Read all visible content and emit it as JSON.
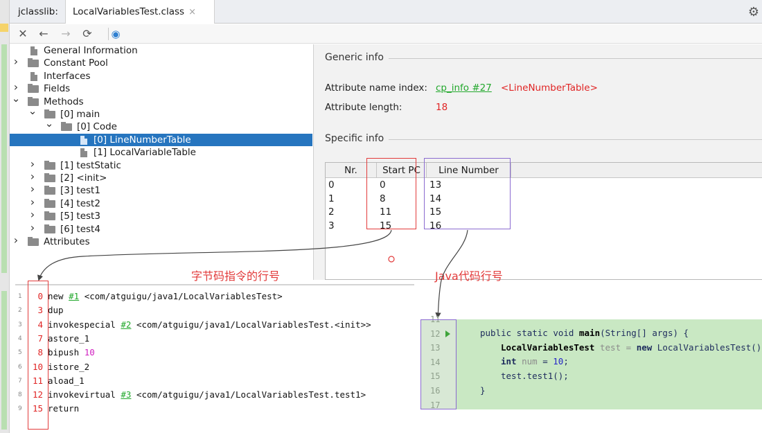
{
  "tabs": [
    {
      "label": "jclasslib:"
    },
    {
      "label": "LocalVariablesTest.class",
      "close": "×"
    }
  ],
  "toolbar": {
    "close": "✕",
    "back": "←",
    "forward": "→",
    "refresh": "⟳",
    "globe": "◉",
    "settings": "⚙"
  },
  "tree": [
    {
      "label": "General Information",
      "depth": 0,
      "expander": "",
      "icon": "file"
    },
    {
      "label": "Constant Pool",
      "depth": 0,
      "expander": "collapsed",
      "icon": "folder"
    },
    {
      "label": "Interfaces",
      "depth": 0,
      "expander": "",
      "icon": "file"
    },
    {
      "label": "Fields",
      "depth": 0,
      "expander": "collapsed",
      "icon": "folder"
    },
    {
      "label": "Methods",
      "depth": 0,
      "expander": "expanded",
      "icon": "folder"
    },
    {
      "label": "[0] main",
      "depth": 1,
      "expander": "expanded",
      "icon": "folder"
    },
    {
      "label": "[0] Code",
      "depth": 2,
      "expander": "expanded",
      "icon": "folder"
    },
    {
      "label": "[0] LineNumberTable",
      "depth": 3,
      "expander": "",
      "icon": "file",
      "selected": true
    },
    {
      "label": "[1] LocalVariableTable",
      "depth": 3,
      "expander": "",
      "icon": "file"
    },
    {
      "label": "[1] testStatic",
      "depth": 1,
      "expander": "collapsed",
      "icon": "folder"
    },
    {
      "label": "[2] <init>",
      "depth": 1,
      "expander": "collapsed",
      "icon": "folder"
    },
    {
      "label": "[3] test1",
      "depth": 1,
      "expander": "collapsed",
      "icon": "folder"
    },
    {
      "label": "[4] test2",
      "depth": 1,
      "expander": "collapsed",
      "icon": "folder"
    },
    {
      "label": "[5] test3",
      "depth": 1,
      "expander": "collapsed",
      "icon": "folder"
    },
    {
      "label": "[6] test4",
      "depth": 1,
      "expander": "collapsed",
      "icon": "folder"
    },
    {
      "label": "Attributes",
      "depth": 0,
      "expander": "collapsed",
      "icon": "folder"
    }
  ],
  "generic": {
    "title": "Generic info",
    "name_label": "Attribute name index:",
    "name_link": "cp_info #27",
    "name_value": "<LineNumberTable>",
    "length_label": "Attribute length:",
    "length_value": "18"
  },
  "specific": {
    "title": "Specific info",
    "columns": [
      "Nr.",
      "Start PC",
      "Line Number"
    ],
    "rows": [
      [
        "0",
        "0",
        "13"
      ],
      [
        "1",
        "8",
        "14"
      ],
      [
        "2",
        "11",
        "15"
      ],
      [
        "3",
        "15",
        "16"
      ]
    ]
  },
  "annotations": {
    "bytecode_label": "字节码指令的行号",
    "java_label": "Java代码行号"
  },
  "bytecode": [
    {
      "line": "1",
      "pc": "0",
      "op": "new",
      "arg": "#1",
      "rest": "<com/atguigu/java1/LocalVariablesTest>"
    },
    {
      "line": "2",
      "pc": "3",
      "op": "dup"
    },
    {
      "line": "3",
      "pc": "4",
      "op": "invokespecial",
      "arg": "#2",
      "rest": "<com/atguigu/java1/LocalVariablesTest.<init>>"
    },
    {
      "line": "4",
      "pc": "7",
      "op": "astore_1"
    },
    {
      "line": "5",
      "pc": "8",
      "op": "bipush",
      "num": "10"
    },
    {
      "line": "6",
      "pc": "10",
      "op": "istore_2"
    },
    {
      "line": "7",
      "pc": "11",
      "op": "aload_1"
    },
    {
      "line": "8",
      "pc": "12",
      "op": "invokevirtual",
      "arg": "#3",
      "rest": "<com/atguigu/java1/LocalVariablesTest.test1>"
    },
    {
      "line": "9",
      "pc": "15",
      "op": "return"
    }
  ],
  "java": {
    "lines": [
      "11",
      "12",
      "13",
      "14",
      "15",
      "16",
      "17"
    ],
    "code": {
      "l12_kw": "public static void",
      "l12_name": "main",
      "l12_rest": "(String[] args) {",
      "l13_cls": "LocalVariablesTest",
      "l13_mid": "test =",
      "l13_new": "new",
      "l13_rest": "LocalVariablesTest();",
      "l14_kw": "int",
      "l14_var": "num",
      "l14_eq": "=",
      "l14_num": "10",
      "l14_end": ";",
      "l15": "test.test1();",
      "l16": "}"
    }
  },
  "colors": {
    "selection": "#2675bf",
    "link": "#22a82c",
    "value_red": "#e02424",
    "annotation_red": "#e23a3a",
    "annotation_purple": "#8a6ad0",
    "java_bg": "#c9e8c3"
  }
}
